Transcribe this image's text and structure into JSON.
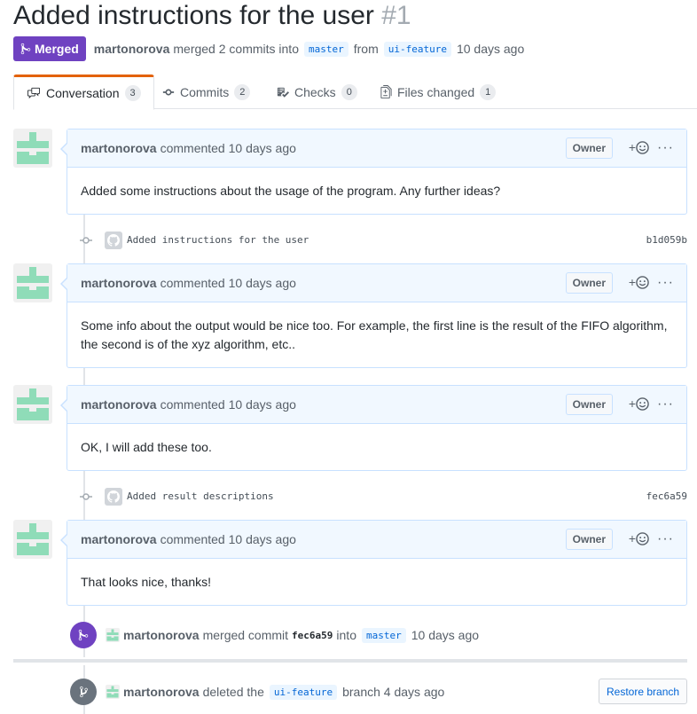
{
  "pr": {
    "title": "Added instructions for the user",
    "number": "#1",
    "state": "Merged",
    "author": "martonorova",
    "merge_text": "merged 2 commits into",
    "base_branch": "master",
    "from_text": "from",
    "head_branch": "ui-feature",
    "time": "10 days ago"
  },
  "tabs": [
    {
      "label": "Conversation",
      "count": "3",
      "icon": "comment-discussion-icon"
    },
    {
      "label": "Commits",
      "count": "2",
      "icon": "git-commit-icon"
    },
    {
      "label": "Checks",
      "count": "0",
      "icon": "checklist-icon"
    },
    {
      "label": "Files changed",
      "count": "1",
      "icon": "diff-icon"
    }
  ],
  "comments": [
    {
      "author": "martonorova",
      "action": "commented 10 days ago",
      "role": "Owner",
      "body": "Added some instructions about the usage of the program. Any further ideas?"
    },
    {
      "author": "martonorova",
      "action": "commented 10 days ago",
      "role": "Owner",
      "body": "Some info about the output would be nice too. For example, the first line is the result of the FIFO algorithm, the second is of the xyz algorithm, etc.."
    },
    {
      "author": "martonorova",
      "action": "commented 10 days ago",
      "role": "Owner",
      "body": "OK, I will add these too."
    },
    {
      "author": "martonorova",
      "action": "commented 10 days ago",
      "role": "Owner",
      "body": "That looks nice, thanks!"
    }
  ],
  "commits": [
    {
      "message": "Added instructions for the user",
      "sha": "b1d059b"
    },
    {
      "message": "Added result descriptions",
      "sha": "fec6a59"
    }
  ],
  "merge_event": {
    "author": "martonorova",
    "action": "merged commit",
    "sha": "fec6a59",
    "into": "into",
    "branch": "master",
    "time": "10 days ago"
  },
  "delete_event": {
    "author": "martonorova",
    "action": "deleted the",
    "branch": "ui-feature",
    "suffix": "branch 4 days ago",
    "button": "Restore branch"
  },
  "colors": {
    "merged": "#6f42c1",
    "avatar_identicon": "#8fdcb8",
    "deleted_badge": "#6a737d",
    "link": "#0366d6"
  }
}
